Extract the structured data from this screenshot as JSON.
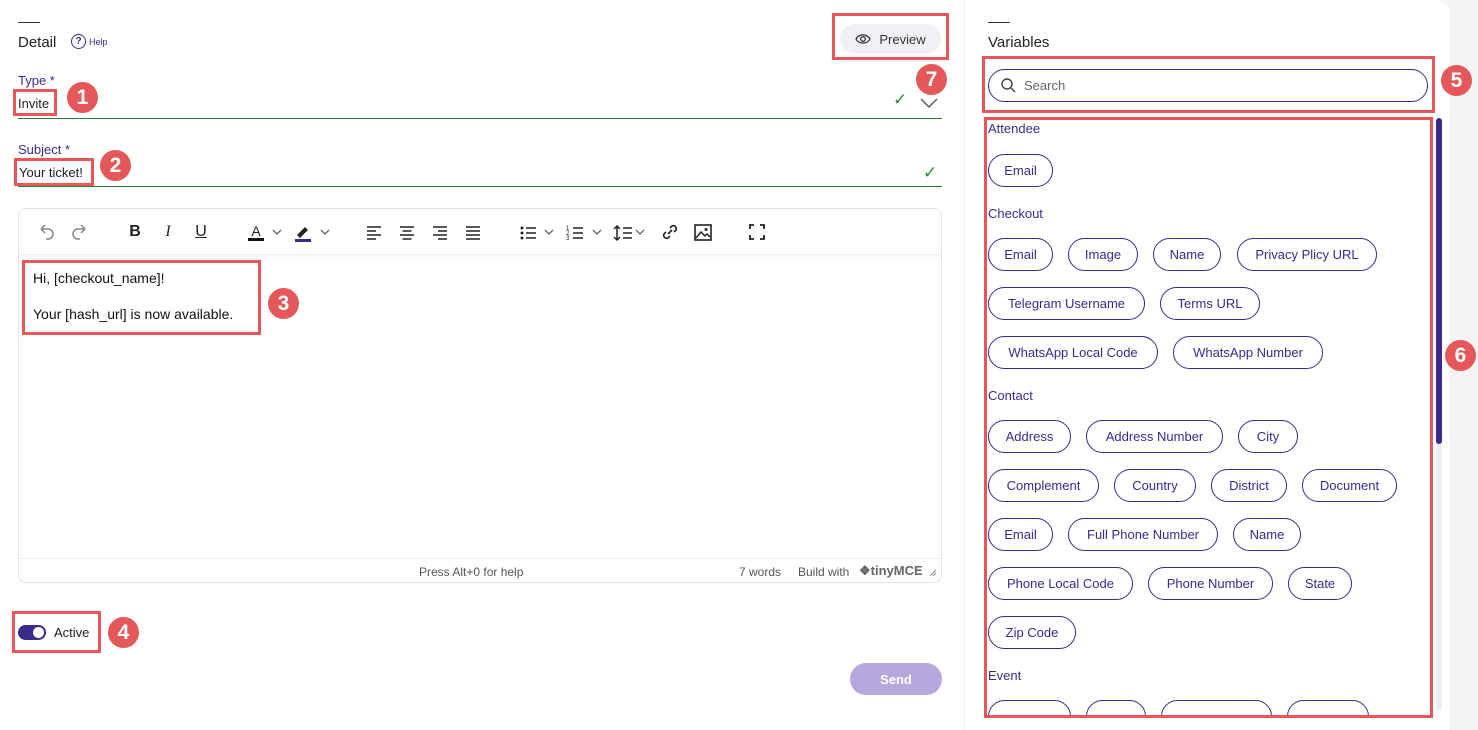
{
  "detail": {
    "title": "Detail",
    "help_label": "Help",
    "help_icon": "?"
  },
  "preview": {
    "label": "Preview"
  },
  "type_field": {
    "label": "Type *",
    "value": "Invite"
  },
  "subject_field": {
    "label": "Subject *",
    "value": "Your ticket!"
  },
  "editor": {
    "content": [
      "Hi, [checkout_name]!",
      "Your [hash_url] is now available."
    ],
    "status_help": "Press Alt+0 for help",
    "word_count": "7 words",
    "build_with": "Build with",
    "brand": "tinyMCE"
  },
  "active": {
    "label": "Active",
    "checked": true
  },
  "send": {
    "label": "Send"
  },
  "variables": {
    "title": "Variables",
    "search_placeholder": "Search",
    "sections": [
      {
        "title": "Attendee",
        "chips": [
          "Email"
        ]
      },
      {
        "title": "Checkout",
        "chips": [
          "Email",
          "Image",
          "Name",
          "Privacy Plicy URL",
          "Telegram Username",
          "Terms URL",
          "WhatsApp Local Code",
          "WhatsApp Number"
        ]
      },
      {
        "title": "Contact",
        "chips": [
          "Address",
          "Address Number",
          "City",
          "Complement",
          "Country",
          "District",
          "Document",
          "Email",
          "Full Phone Number",
          "Name",
          "Phone Local Code",
          "Phone Number",
          "State",
          "Zip Code"
        ]
      },
      {
        "title": "Event",
        "chips": []
      }
    ]
  },
  "annotations": [
    "1",
    "2",
    "3",
    "4",
    "5",
    "6",
    "7"
  ],
  "colors": {
    "accent": "#3b2a8a",
    "highlight": "#e4585a",
    "valid": "#2e8b3a",
    "send_disabled": "#b6a8dd"
  }
}
